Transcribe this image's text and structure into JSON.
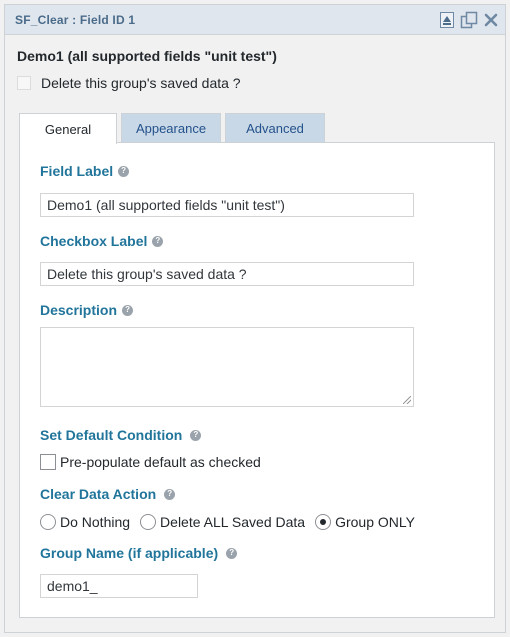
{
  "titlebar": {
    "title": "SF_Clear : Field ID 1",
    "icons": [
      "move-up-icon",
      "duplicate-icon",
      "close-icon"
    ]
  },
  "group": {
    "title": "Demo1 (all supported fields \"unit test\")",
    "checkbox_label": "Delete this group's saved data ?"
  },
  "tabs": [
    {
      "label": "General",
      "active": true
    },
    {
      "label": "Appearance",
      "active": false
    },
    {
      "label": "Advanced",
      "active": false
    }
  ],
  "fields": {
    "field_label": {
      "label": "Field Label",
      "value": "Demo1 (all supported fields \"unit test\")"
    },
    "checkbox_label": {
      "label": "Checkbox Label",
      "value": "Delete this group's saved data ?"
    },
    "description": {
      "label": "Description",
      "value": ""
    },
    "default_condition": {
      "label": "Set Default Condition",
      "option_label": "Pre-populate default as checked",
      "checked": false
    },
    "clear_action": {
      "label": "Clear Data Action",
      "options": [
        "Do Nothing",
        "Delete ALL Saved Data",
        "Group ONLY"
      ],
      "selected": "Group ONLY"
    },
    "group_name": {
      "label": "Group Name (if applicable)",
      "value": "demo1_"
    }
  },
  "colors": {
    "label_blue": "#21759b",
    "tab_inactive_bg": "#c9d8e6",
    "titlebar_bg": "#dfe6ed"
  }
}
